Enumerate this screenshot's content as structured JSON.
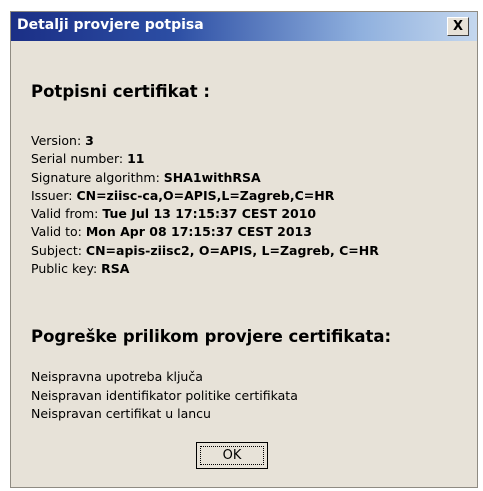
{
  "window": {
    "title": "Detalji provjere potpisa",
    "close_label": "X"
  },
  "certificate": {
    "heading": "Potpisni certifikat :",
    "fields": [
      {
        "label": "Version: ",
        "value": "3"
      },
      {
        "label": "Serial number: ",
        "value": "11"
      },
      {
        "label": "Signature algorithm: ",
        "value": "SHA1withRSA"
      },
      {
        "label": "Issuer: ",
        "value": "CN=ziisc-ca,O=APIS,L=Zagreb,C=HR"
      },
      {
        "label": "Valid from: ",
        "value": "Tue Jul 13 17:15:37 CEST 2010"
      },
      {
        "label": "Valid to: ",
        "value": "Mon Apr 08 17:15:37 CEST 2013"
      },
      {
        "label": "Subject: ",
        "value": "CN=apis-ziisc2, O=APIS, L=Zagreb, C=HR"
      },
      {
        "label": "Public key: ",
        "value": "RSA"
      }
    ]
  },
  "errors": {
    "heading": "Pogreške prilikom provjere certifikata:",
    "items": [
      "Neispravna upotreba ključa",
      "Neispravan identifikator politike certifikata",
      "Neispravan certifikat u lancu"
    ]
  },
  "buttons": {
    "ok_label": "OK"
  }
}
